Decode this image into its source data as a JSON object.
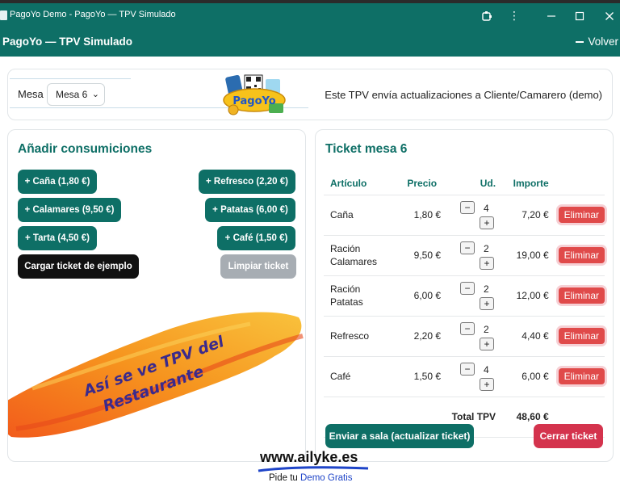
{
  "window": {
    "title": "PagoYo Demo - PagoYo — TPV Simulado"
  },
  "header": {
    "title": "PagoYo — TPV Simulado",
    "back_label": "Volver"
  },
  "top": {
    "mesa_label": "Mesa",
    "mesa_selected": "Mesa 6",
    "logo_text": "PagoYo",
    "note": "Este TPV envía actualizaciones a Cliente/Camarero (demo)"
  },
  "left": {
    "title": "Añadir consumiciones",
    "buttons": {
      "cana": "+ Caña (1,80 €)",
      "refresco": "+ Refresco (2,20 €)",
      "calamares": "+ Calamares (9,50 €)",
      "patatas": "+ Patatas (6,00 €)",
      "tarta": "+ Tarta (4,50 €)",
      "cafe": "+ Café (1,50 €)",
      "cargar": "Cargar ticket de ejemplo",
      "limpiar": "Limpiar ticket"
    },
    "overlay_line1": "Así se ve TPV del",
    "overlay_line2": "Restaurante"
  },
  "ticket": {
    "title": "Ticket mesa 6",
    "headers": {
      "articulo": "Artículo",
      "precio": "Precio",
      "ud": "Ud.",
      "importe": "Importe"
    },
    "rows": [
      {
        "articulo": "Caña",
        "precio": "1,80 €",
        "ud": "4",
        "importe": "7,20 €"
      },
      {
        "articulo": "Ración Calamares",
        "precio": "9,50 €",
        "ud": "2",
        "importe": "19,00 €"
      },
      {
        "articulo": "Ración Patatas",
        "precio": "6,00 €",
        "ud": "2",
        "importe": "12,00 €"
      },
      {
        "articulo": "Refresco",
        "precio": "2,20 €",
        "ud": "2",
        "importe": "4,40 €"
      },
      {
        "articulo": "Café",
        "precio": "1,50 €",
        "ud": "4",
        "importe": "6,00 €"
      }
    ],
    "minus": "−",
    "plus": "+",
    "delete_label": "Eliminar",
    "total_label": "Total TPV",
    "total_value": "48,60 €",
    "send_label": "Enviar a sala (actualizar ticket)",
    "close_label": "Cerrar ticket"
  },
  "brand": {
    "site": "www.ailyke.es",
    "tag_prefix": "Pide tu ",
    "tag_highlight": "Demo Gratis"
  },
  "colors": {
    "primary": "#0e6f66",
    "danger": "#d4334d",
    "delete": "#e04a4a",
    "dark": "#111111",
    "muted": "#a7adb3",
    "overlay_text": "#3b2a8c"
  }
}
